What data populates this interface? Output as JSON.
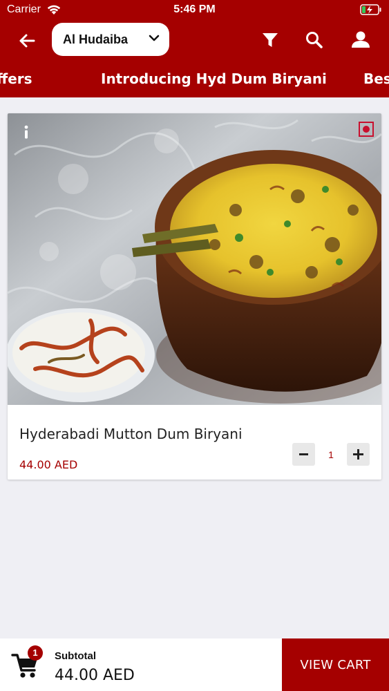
{
  "status_bar": {
    "carrier": "Carrier",
    "time": "5:46 PM",
    "icons": [
      "wifi-icon",
      "battery-charging-icon"
    ]
  },
  "header": {
    "branch": "Al Hudaiba",
    "icons": [
      "back-arrow-icon",
      "chevron-down-icon",
      "filter-icon",
      "search-icon",
      "user-icon"
    ],
    "brand_color": "#a50000"
  },
  "tabs": [
    {
      "label": "Offers"
    },
    {
      "label": "Introducing Hyd Dum Biryani"
    },
    {
      "label": "Best"
    }
  ],
  "item": {
    "name": "Hyderabadi Mutton Dum Biryani",
    "price": "44.00 AED",
    "quantity": "1",
    "info_icon": "info-icon",
    "diet_mark": "non-veg-indicator",
    "diet_color": "#c8102e"
  },
  "cart": {
    "count": "1",
    "subtotal_label": "Subtotal",
    "subtotal_value": "44.00 AED",
    "button_label": "VIEW CART"
  }
}
